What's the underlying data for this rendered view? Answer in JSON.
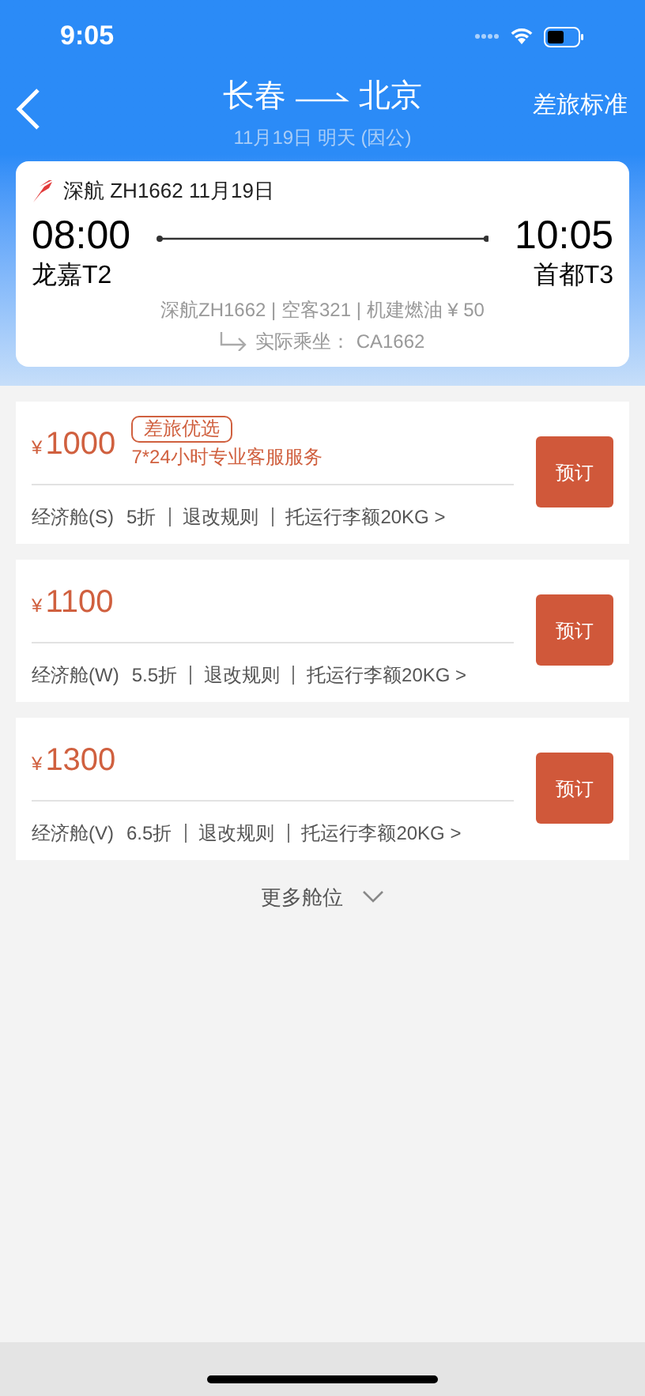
{
  "status_bar": {
    "time": "9:05"
  },
  "nav": {
    "origin": "长春",
    "destination": "北京",
    "subtitle": "11月19日 明天 (因公)",
    "action": "差旅标准"
  },
  "flight": {
    "airline": "深航 ZH1662 11月19日",
    "depart_time": "08:00",
    "depart_airport": "龙嘉T2",
    "arrive_time": "10:05",
    "arrive_airport": "首都T3",
    "details": "深航ZH1662 | 空客321 | 机建燃油 ¥ 50",
    "actual_label": "实际乘坐：",
    "actual_flight": "CA1662"
  },
  "fares": [
    {
      "currency": "¥",
      "price": "1000",
      "badge": "差旅优选",
      "note": "7*24小时专业客服服务",
      "cabin": "经济舱(S)",
      "discount": "5折",
      "rules": "退改规则",
      "baggage": "托运行李额20KG >",
      "button": "预订"
    },
    {
      "currency": "¥",
      "price": "1100",
      "cabin": "经济舱(W)",
      "discount": "5.5折",
      "rules": "退改规则",
      "baggage": "托运行李额20KG >",
      "button": "预订"
    },
    {
      "currency": "¥",
      "price": "1300",
      "cabin": "经济舱(V)",
      "discount": "6.5折",
      "rules": "退改规则",
      "baggage": "托运行李额20KG >",
      "button": "预订"
    }
  ],
  "more": {
    "label": "更多舱位"
  }
}
